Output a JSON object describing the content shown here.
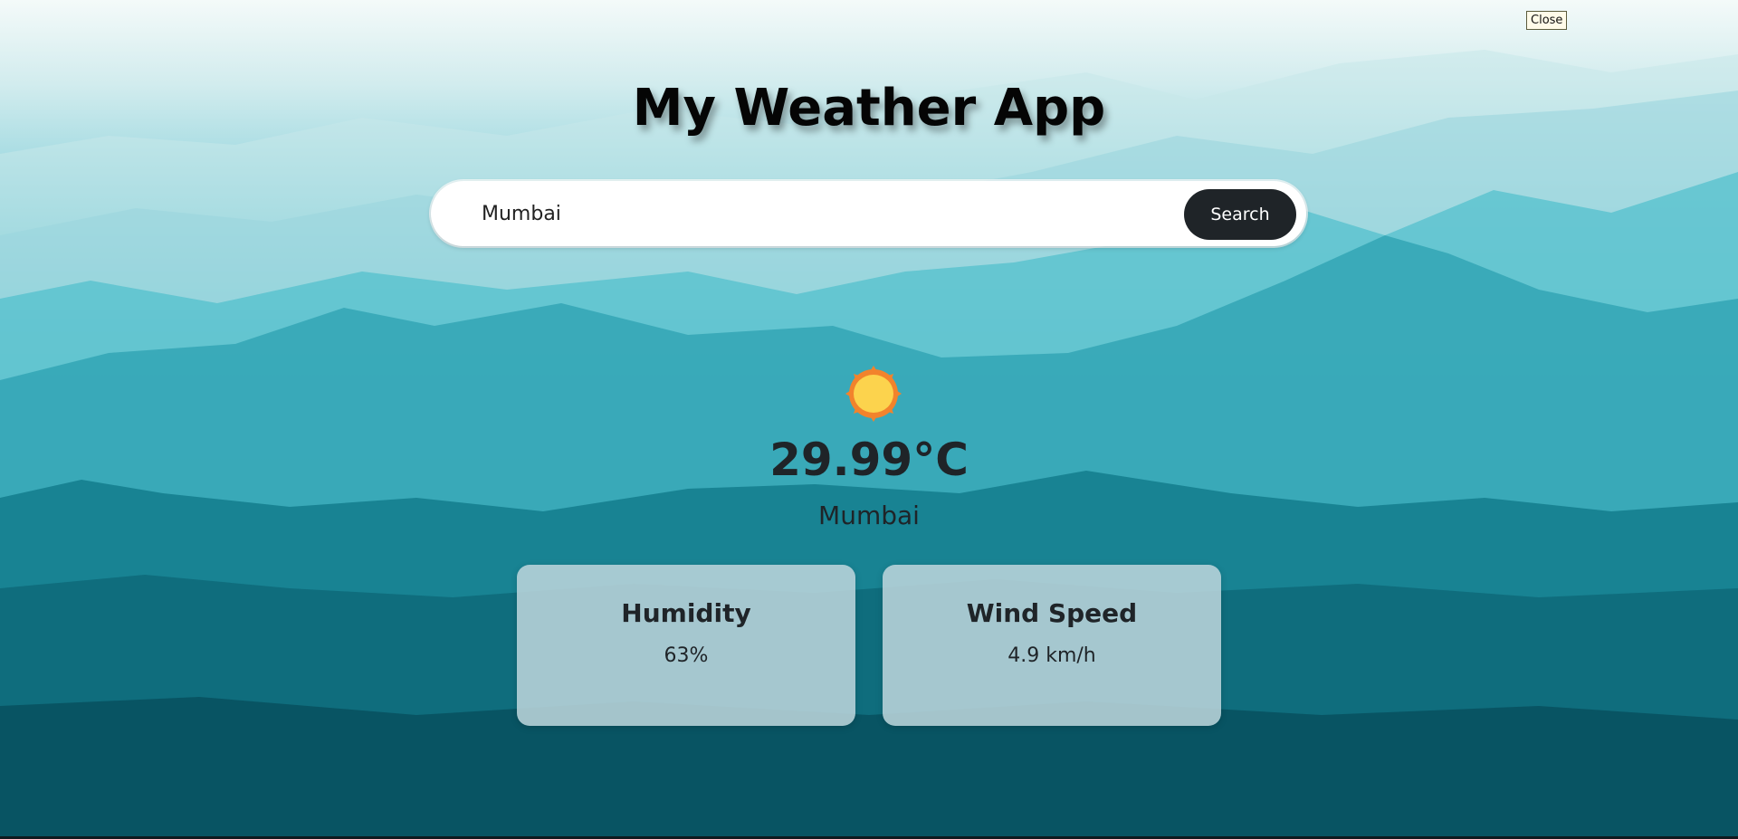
{
  "close_button": {
    "label": "Close"
  },
  "app": {
    "title": "My Weather App"
  },
  "search": {
    "value": "Mumbai",
    "button_label": "Search"
  },
  "weather": {
    "icon": "sun-icon",
    "temperature": "29.99°C",
    "city": "Mumbai"
  },
  "details": {
    "humidity": {
      "label": "Humidity",
      "value": "63%"
    },
    "wind": {
      "label": "Wind Speed",
      "value": "4.9 km/h"
    }
  },
  "colors": {
    "accent_button": "#1f2428",
    "sun_fill": "#fcd34d",
    "sun_rays": "#f2832c",
    "card_bg": "#bed6dc"
  }
}
